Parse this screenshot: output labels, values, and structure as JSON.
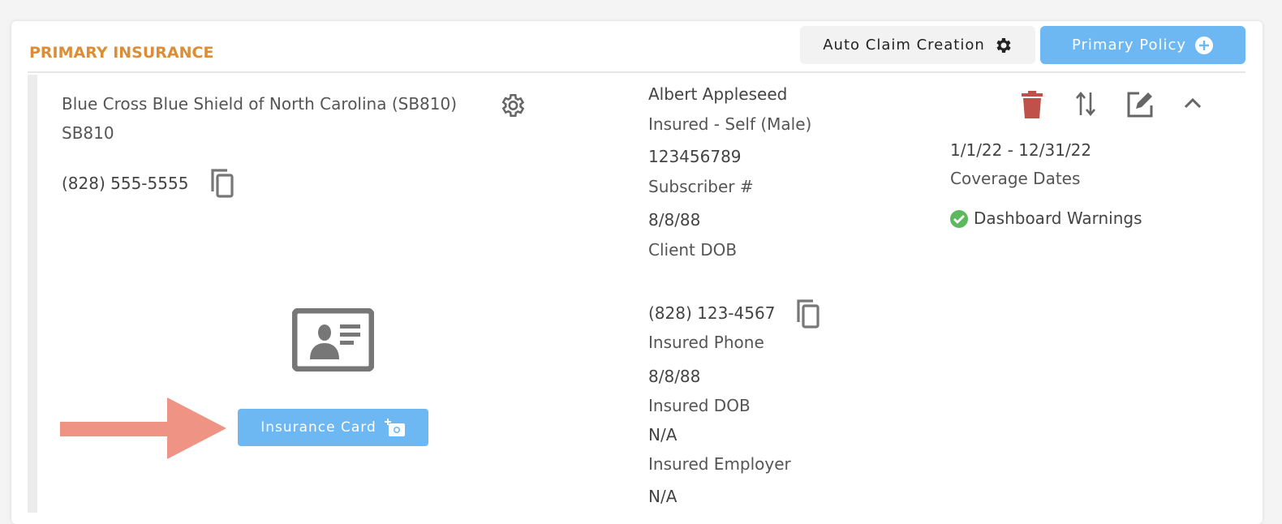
{
  "section_title": "PRIMARY INSURANCE",
  "toolbar": {
    "auto_claim_label": "Auto Claim Creation",
    "primary_policy_label": "Primary Policy"
  },
  "payer": {
    "name": "Blue Cross Blue Shield of North Carolina (SB810)",
    "id": "SB810",
    "phone": "(828) 555-5555"
  },
  "insured": {
    "name": "Albert Appleseed",
    "relationship": "Insured - Self (Male)",
    "subscriber_number": "123456789",
    "subscriber_label": "Subscriber #",
    "client_dob": "8/8/88",
    "client_dob_label": "Client DOB",
    "phone": "(828) 123-4567",
    "phone_label": "Insured Phone",
    "dob": "8/8/88",
    "dob_label": "Insured DOB",
    "employer": "N/A",
    "employer_label": "Insured Employer",
    "extra": "N/A"
  },
  "coverage": {
    "dates": "1/1/22 - 12/31/22",
    "dates_label": "Coverage Dates",
    "warnings_label": "Dashboard Warnings"
  },
  "insurance_card_label": "Insurance Card",
  "colors": {
    "accent": "#dc8d35",
    "button_blue": "#6db8f3",
    "delete_red": "#c0504a",
    "success_green": "#5cb85c",
    "arrow": "#ef9484"
  }
}
